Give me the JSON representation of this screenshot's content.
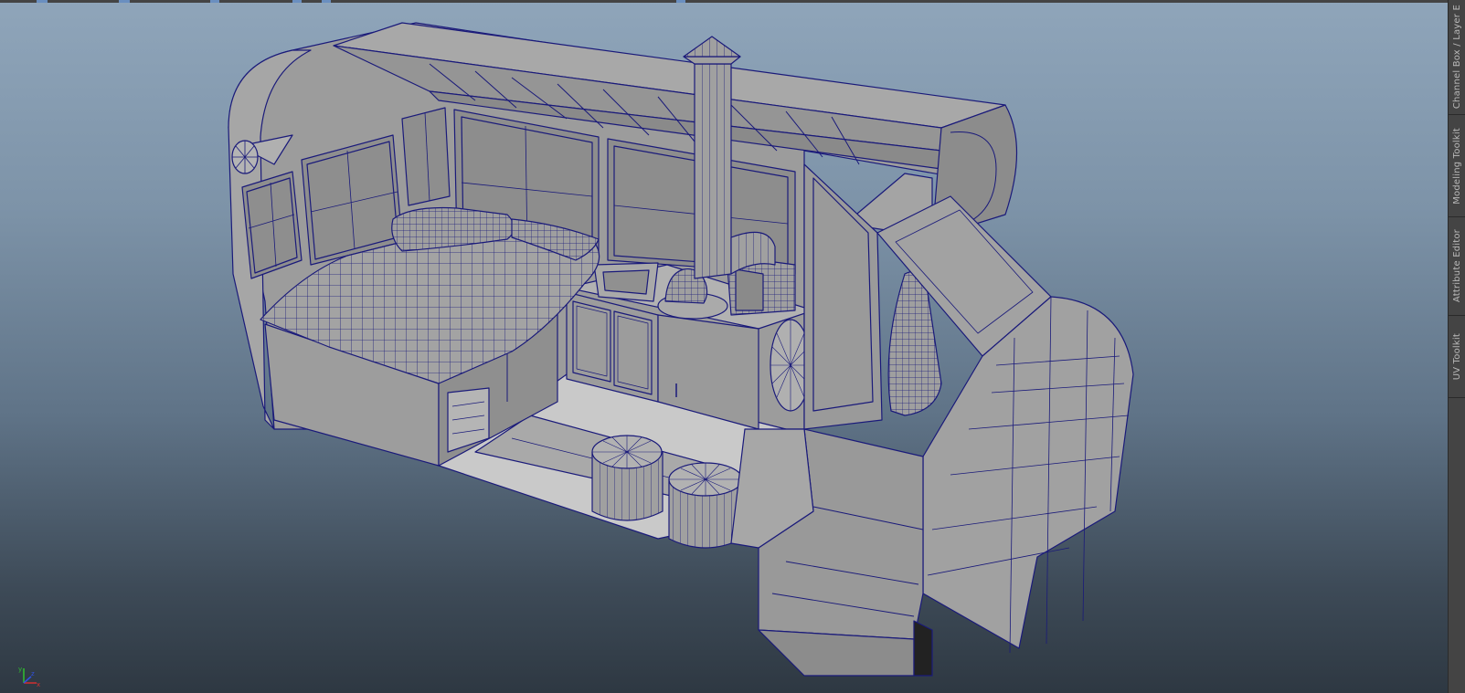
{
  "app": {
    "name": "Maya viewport",
    "background_top": "#8fa5ba",
    "background_bottom": "#2e3842",
    "wireframe_color": "#1a1a7a",
    "surface_color": "#9a9a9a"
  },
  "side_dock": {
    "tabs": [
      {
        "label": "Channel Box / Layer E"
      },
      {
        "label": "Modeling Toolkit"
      },
      {
        "label": "Attribute Editor"
      },
      {
        "label": "UV Toolkit"
      }
    ]
  },
  "gizmo": {
    "axes": [
      "x",
      "y",
      "z"
    ],
    "x_color": "#d23030",
    "y_color": "#2fbf2f",
    "z_color": "#3050e0"
  }
}
